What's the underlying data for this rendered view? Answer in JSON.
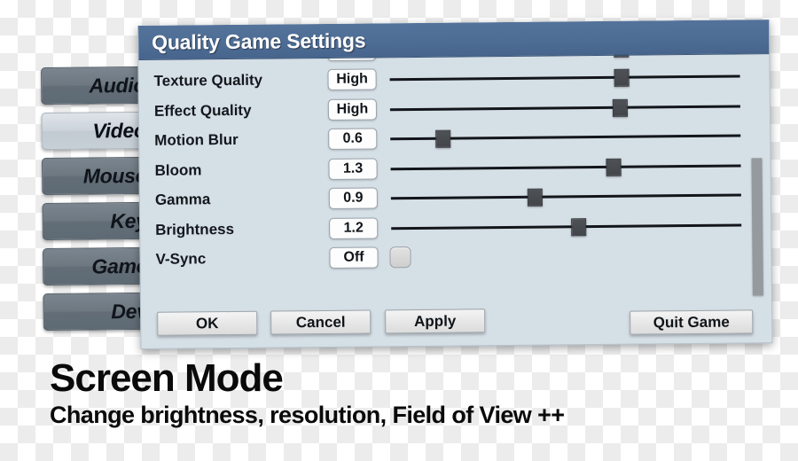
{
  "sidebar": {
    "items": [
      {
        "label": "Audio",
        "selected": false
      },
      {
        "label": "Video",
        "selected": true
      },
      {
        "label": "Mouse",
        "selected": false
      },
      {
        "label": "Key",
        "selected": false
      },
      {
        "label": "Game",
        "selected": false
      },
      {
        "label": "Dev",
        "selected": false
      }
    ]
  },
  "dialog": {
    "title": "Quality Game Settings",
    "title_bar_color": "#4e6d95",
    "body_color": "#d5dfe6",
    "rows": [
      {
        "label": "",
        "value": "",
        "control": "slider",
        "slider_pct": 66,
        "clipped": true
      },
      {
        "label": "Texture Quality",
        "value": "High",
        "control": "slider",
        "slider_pct": 66
      },
      {
        "label": "Effect Quality",
        "value": "High",
        "control": "slider",
        "slider_pct": 65.5
      },
      {
        "label": "Motion Blur",
        "value": "0.6",
        "control": "slider",
        "slider_pct": 15
      },
      {
        "label": "Bloom",
        "value": "1.3",
        "control": "slider",
        "slider_pct": 63.5
      },
      {
        "label": "Gamma",
        "value": "0.9",
        "control": "slider",
        "slider_pct": 41
      },
      {
        "label": "Brightness",
        "value": "1.2",
        "control": "slider",
        "slider_pct": 53.5
      },
      {
        "label": "V-Sync",
        "value": "Off",
        "control": "checkbox",
        "checked": false
      }
    ],
    "scrollbar": {
      "thumb_color": "#949a9e"
    },
    "buttons": {
      "ok": "OK",
      "cancel": "Cancel",
      "apply": "Apply",
      "quit": "Quit Game"
    }
  },
  "caption": {
    "title": "Screen Mode",
    "subtitle": "Change brightness, resolution, Field of View ++"
  }
}
